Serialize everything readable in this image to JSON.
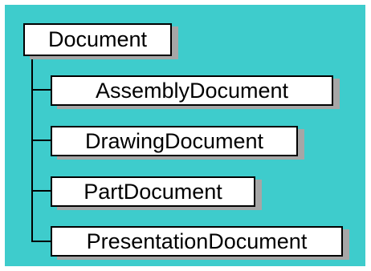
{
  "diagram": {
    "background_color": "#3ecccc",
    "node_fill": "#ffffff",
    "node_border": "#000000",
    "node_shadow": "#a6a6a6",
    "root": {
      "label": "Document"
    },
    "children": [
      {
        "label": "AssemblyDocument"
      },
      {
        "label": "DrawingDocument"
      },
      {
        "label": "PartDocument"
      },
      {
        "label": "PresentationDocument"
      }
    ]
  }
}
